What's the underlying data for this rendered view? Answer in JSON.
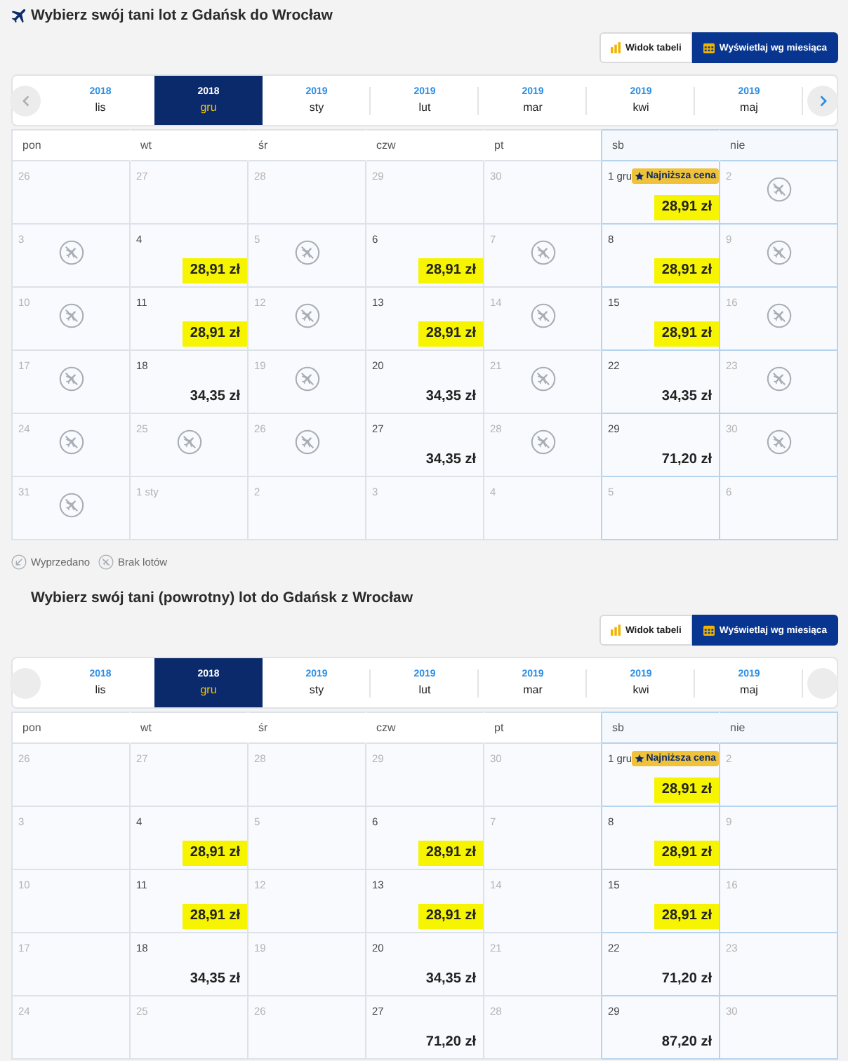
{
  "sections": [
    {
      "title": "Wybierz swój tani lot z Gdańsk do Wrocław",
      "view_toggle": [
        {
          "label": "Widok tabeli",
          "selected": false
        },
        {
          "label": "Wyświetlaj wg miesiąca",
          "selected": true
        }
      ],
      "month_carousel": {
        "nav": [
          {
            "kind": "prev",
            "arrow": true,
            "disabled": true
          },
          {
            "kind": "next",
            "arrow": true,
            "disabled": false
          }
        ],
        "months": [
          {
            "year": "2018",
            "month": "lis",
            "selected": false
          },
          {
            "year": "2018",
            "month": "gru",
            "selected": true
          },
          {
            "year": "2019",
            "month": "sty",
            "selected": false
          },
          {
            "year": "2019",
            "month": "lut",
            "selected": false
          },
          {
            "year": "2019",
            "month": "mar",
            "selected": false
          },
          {
            "year": "2019",
            "month": "kwi",
            "selected": false
          },
          {
            "year": "2019",
            "month": "maj",
            "selected": false
          }
        ]
      },
      "calendar": {
        "day_names": [
          {
            "label": "pon",
            "weekend": false
          },
          {
            "label": "wt",
            "weekend": false
          },
          {
            "label": "śr",
            "weekend": false
          },
          {
            "label": "czw",
            "weekend": false
          },
          {
            "label": "pt",
            "weekend": false
          },
          {
            "label": "sb",
            "weekend": true
          },
          {
            "label": "nie",
            "weekend": true
          }
        ],
        "weeks": [
          {
            "days": [
              {
                "day": "26",
                "kind": "empty"
              },
              {
                "day": "27",
                "kind": "empty"
              },
              {
                "day": "28",
                "kind": "empty"
              },
              {
                "day": "29",
                "kind": "empty"
              },
              {
                "day": "30",
                "kind": "empty"
              },
              {
                "day": "1 gru",
                "kind": "price",
                "price": "28,91 zł",
                "highlighted": true,
                "badge": "Najniższa cena"
              },
              {
                "day": "2",
                "kind": "no_flights"
              }
            ]
          },
          {
            "days": [
              {
                "day": "3",
                "kind": "no_flights"
              },
              {
                "day": "4",
                "kind": "price",
                "price": "28,91 zł",
                "highlighted": true
              },
              {
                "day": "5",
                "kind": "no_flights"
              },
              {
                "day": "6",
                "kind": "price",
                "price": "28,91 zł",
                "highlighted": true
              },
              {
                "day": "7",
                "kind": "no_flights"
              },
              {
                "day": "8",
                "kind": "price",
                "price": "28,91 zł",
                "highlighted": true
              },
              {
                "day": "9",
                "kind": "no_flights"
              }
            ]
          },
          {
            "days": [
              {
                "day": "10",
                "kind": "no_flights"
              },
              {
                "day": "11",
                "kind": "price",
                "price": "28,91 zł",
                "highlighted": true
              },
              {
                "day": "12",
                "kind": "no_flights"
              },
              {
                "day": "13",
                "kind": "price",
                "price": "28,91 zł",
                "highlighted": true
              },
              {
                "day": "14",
                "kind": "no_flights"
              },
              {
                "day": "15",
                "kind": "price",
                "price": "28,91 zł",
                "highlighted": true
              },
              {
                "day": "16",
                "kind": "no_flights"
              }
            ]
          },
          {
            "days": [
              {
                "day": "17",
                "kind": "no_flights"
              },
              {
                "day": "18",
                "kind": "price",
                "price": "34,35 zł",
                "highlighted": false
              },
              {
                "day": "19",
                "kind": "no_flights"
              },
              {
                "day": "20",
                "kind": "price",
                "price": "34,35 zł",
                "highlighted": false
              },
              {
                "day": "21",
                "kind": "no_flights"
              },
              {
                "day": "22",
                "kind": "price",
                "price": "34,35 zł",
                "highlighted": false
              },
              {
                "day": "23",
                "kind": "no_flights"
              }
            ]
          },
          {
            "days": [
              {
                "day": "24",
                "kind": "no_flights"
              },
              {
                "day": "25",
                "kind": "no_flights"
              },
              {
                "day": "26",
                "kind": "no_flights"
              },
              {
                "day": "27",
                "kind": "price",
                "price": "34,35 zł",
                "highlighted": false
              },
              {
                "day": "28",
                "kind": "no_flights"
              },
              {
                "day": "29",
                "kind": "price",
                "price": "71,20 zł",
                "highlighted": false
              },
              {
                "day": "30",
                "kind": "no_flights"
              }
            ]
          },
          {
            "days": [
              {
                "day": "31",
                "kind": "no_flights"
              },
              {
                "day": "1 sty",
                "kind": "empty"
              },
              {
                "day": "2",
                "kind": "empty"
              },
              {
                "day": "3",
                "kind": "empty"
              },
              {
                "day": "4",
                "kind": "empty"
              },
              {
                "day": "5",
                "kind": "empty"
              },
              {
                "day": "6",
                "kind": "empty"
              }
            ]
          }
        ]
      },
      "legend": [
        {
          "kind": "sold_out",
          "label": "Wyprzedano"
        },
        {
          "kind": "no_flights",
          "label": "Brak lotów"
        }
      ]
    },
    {
      "title": "Wybierz swój tani (powrotny) lot do Gdańsk z Wrocław",
      "view_toggle": [
        {
          "label": "Widok tabeli",
          "selected": false
        },
        {
          "label": "Wyświetlaj wg miesiąca",
          "selected": true
        }
      ],
      "month_carousel": {
        "nav": [
          {
            "kind": "prev",
            "arrow": false
          },
          {
            "kind": "next",
            "arrow": false
          }
        ],
        "months": [
          {
            "year": "2018",
            "month": "lis",
            "selected": false
          },
          {
            "year": "2018",
            "month": "gru",
            "selected": true
          },
          {
            "year": "2019",
            "month": "sty",
            "selected": false
          },
          {
            "year": "2019",
            "month": "lut",
            "selected": false
          },
          {
            "year": "2019",
            "month": "mar",
            "selected": false
          },
          {
            "year": "2019",
            "month": "kwi",
            "selected": false
          },
          {
            "year": "2019",
            "month": "maj",
            "selected": false
          }
        ]
      },
      "calendar": {
        "day_names": [
          {
            "label": "pon",
            "weekend": false
          },
          {
            "label": "wt",
            "weekend": false
          },
          {
            "label": "śr",
            "weekend": false
          },
          {
            "label": "czw",
            "weekend": false
          },
          {
            "label": "pt",
            "weekend": false
          },
          {
            "label": "sb",
            "weekend": true
          },
          {
            "label": "nie",
            "weekend": true
          }
        ],
        "weeks": [
          {
            "days": [
              {
                "day": "26",
                "kind": "empty"
              },
              {
                "day": "27",
                "kind": "empty"
              },
              {
                "day": "28",
                "kind": "empty"
              },
              {
                "day": "29",
                "kind": "empty"
              },
              {
                "day": "30",
                "kind": "empty"
              },
              {
                "day": "1 gru",
                "kind": "price",
                "price": "28,91 zł",
                "highlighted": true,
                "badge": "Najniższa cena"
              },
              {
                "day": "2",
                "kind": "empty"
              }
            ]
          },
          {
            "days": [
              {
                "day": "3",
                "kind": "empty"
              },
              {
                "day": "4",
                "kind": "price",
                "price": "28,91 zł",
                "highlighted": true
              },
              {
                "day": "5",
                "kind": "empty"
              },
              {
                "day": "6",
                "kind": "price",
                "price": "28,91 zł",
                "highlighted": true
              },
              {
                "day": "7",
                "kind": "empty"
              },
              {
                "day": "8",
                "kind": "price",
                "price": "28,91 zł",
                "highlighted": true
              },
              {
                "day": "9",
                "kind": "empty"
              }
            ]
          },
          {
            "days": [
              {
                "day": "10",
                "kind": "empty"
              },
              {
                "day": "11",
                "kind": "price",
                "price": "28,91 zł",
                "highlighted": true
              },
              {
                "day": "12",
                "kind": "empty"
              },
              {
                "day": "13",
                "kind": "price",
                "price": "28,91 zł",
                "highlighted": true
              },
              {
                "day": "14",
                "kind": "empty"
              },
              {
                "day": "15",
                "kind": "price",
                "price": "28,91 zł",
                "highlighted": true
              },
              {
                "day": "16",
                "kind": "empty"
              }
            ]
          },
          {
            "days": [
              {
                "day": "17",
                "kind": "empty"
              },
              {
                "day": "18",
                "kind": "price",
                "price": "34,35 zł",
                "highlighted": false
              },
              {
                "day": "19",
                "kind": "empty"
              },
              {
                "day": "20",
                "kind": "price",
                "price": "34,35 zł",
                "highlighted": false
              },
              {
                "day": "21",
                "kind": "empty"
              },
              {
                "day": "22",
                "kind": "price",
                "price": "71,20 zł",
                "highlighted": false
              },
              {
                "day": "23",
                "kind": "empty"
              }
            ]
          },
          {
            "days": [
              {
                "day": "24",
                "kind": "empty"
              },
              {
                "day": "25",
                "kind": "empty"
              },
              {
                "day": "26",
                "kind": "empty"
              },
              {
                "day": "27",
                "kind": "price",
                "price": "71,20 zł",
                "highlighted": false
              },
              {
                "day": "28",
                "kind": "empty"
              },
              {
                "day": "29",
                "kind": "price",
                "price": "87,20 zł",
                "highlighted": false
              },
              {
                "day": "30",
                "kind": "empty"
              }
            ]
          }
        ]
      }
    }
  ]
}
